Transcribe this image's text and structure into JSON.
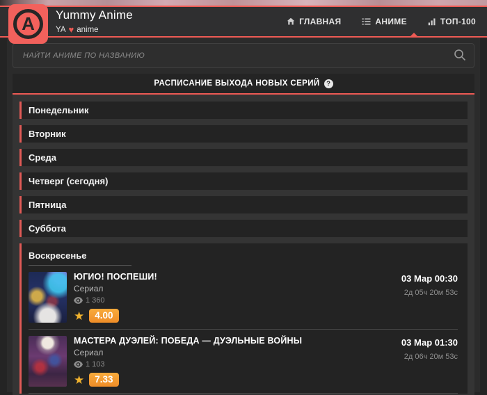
{
  "accent_color": "#ee5a54",
  "badge_color": "#f09a30",
  "header": {
    "title": "Yummy Anime",
    "subtitle_prefix": "YA",
    "heart": "♥",
    "subtitle_suffix": "anime",
    "nav": [
      {
        "label": "ГЛАВНАЯ",
        "icon": "home-icon",
        "active": false
      },
      {
        "label": "АНИМЕ",
        "icon": "list-icon",
        "active": true
      },
      {
        "label": "ТОП-100",
        "icon": "chart-bars-icon",
        "active": false
      }
    ]
  },
  "search": {
    "placeholder": "НАЙТИ АНИМЕ ПО НАЗВАНИЮ",
    "value": ""
  },
  "schedule": {
    "title": "РАСПИСАНИЕ ВЫХОДА НОВЫХ СЕРИЙ",
    "help_glyph": "?",
    "days": [
      {
        "label": "Понедельник"
      },
      {
        "label": "Вторник"
      },
      {
        "label": "Среда"
      },
      {
        "label": "Четверг (сегодня)"
      },
      {
        "label": "Пятница"
      },
      {
        "label": "Суббота"
      },
      {
        "label": "Воскресенье",
        "expanded": true
      }
    ],
    "star_glyph": "★",
    "entries": [
      {
        "title": "ЮГИО! ПОСПЕШИ!",
        "type": "Сериал",
        "views": "1 360",
        "rating": "4.00",
        "air_date": "03 Мар 00:30",
        "countdown": "2д 05ч 20м 53с"
      },
      {
        "title": "МАСТЕРА ДУЭЛЕЙ: ПОБЕДА — ДУЭЛЬНЫЕ ВОЙНЫ",
        "type": "Сериал",
        "views": "1 103",
        "rating": "7.33",
        "air_date": "03 Мар 01:30",
        "countdown": "2д 06ч 20м 53с"
      }
    ]
  }
}
